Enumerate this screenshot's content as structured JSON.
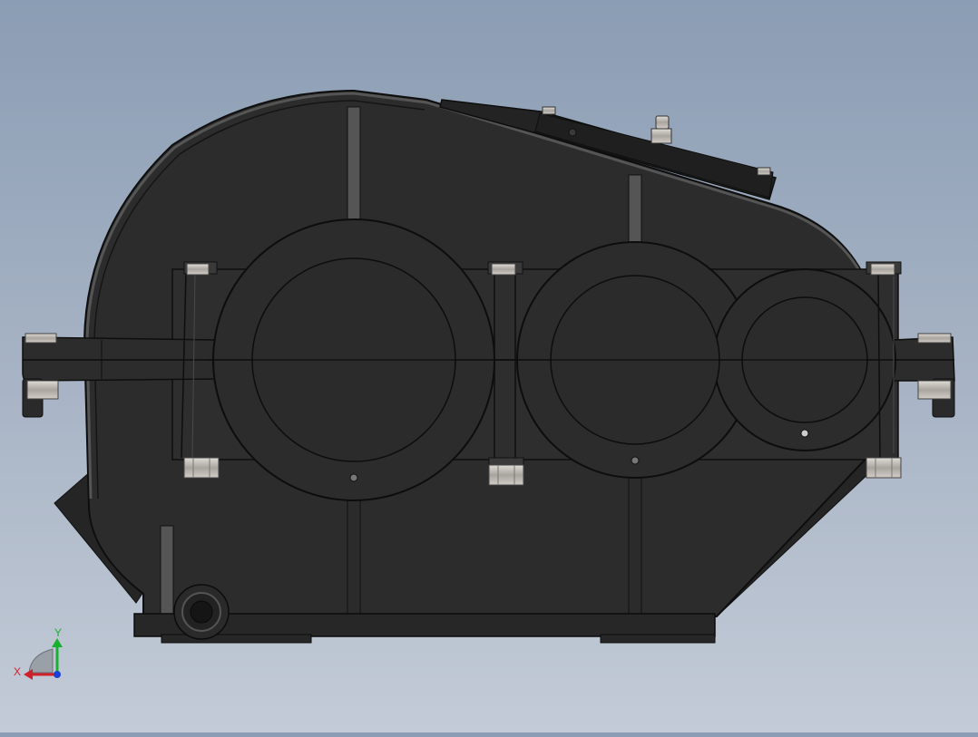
{
  "view": {
    "model": "gear-reducer-housing",
    "background_top": "#8b9db4",
    "background_bottom": "#c3cbd7",
    "body_color": "#2b2b2b",
    "edge_color": "#111111",
    "fastener_color": "#b9b4ae"
  },
  "triad": {
    "x_label": "X",
    "y_label": "Y",
    "x_color": "#d0202a",
    "y_color": "#18b02e",
    "z_color": "#1c3fd8"
  }
}
